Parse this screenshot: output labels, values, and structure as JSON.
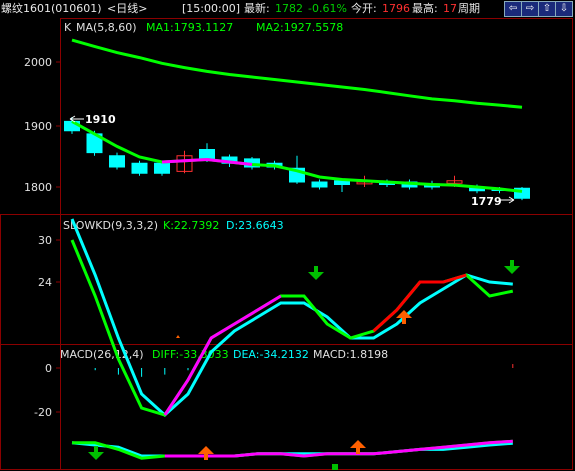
{
  "topbar": {
    "symbol": "螺纹1601",
    "code": "(010601)",
    "period": "<日线>",
    "time": "[15:00:00]",
    "latest_label": "最新:",
    "latest_value": "1782",
    "change": "-0.61%",
    "open_label": "今开:",
    "open_value": "1796",
    "high_label": "最高:",
    "high_value": "17",
    "weekly_tab": "周期",
    "btn_prev": "⇦",
    "btn_next": "⇨",
    "btn_up": "⇧",
    "btn_down": "⇩"
  },
  "colors": {
    "grid": "#8b0000",
    "up": "#ff3030",
    "down": "#00ffff",
    "ma1": "#00ff00",
    "ma2": "#00ff00",
    "k": "#ff0000",
    "d": "#00ffff",
    "magenta": "#ff00ff"
  },
  "main_panel": {
    "label_k": "K",
    "label_ma": "MA(5,8,60)",
    "label_ma1": "MA1:1793.1127",
    "label_ma2": "MA2:1927.5578",
    "high_marker": "1910",
    "low_marker": "1779",
    "yticks": [
      "2000",
      "1900",
      "1800"
    ]
  },
  "kd_panel": {
    "title": "SLOWKD(9,3,3,2)",
    "k_text": "K:22.7392",
    "d_text": "D:23.6643",
    "yticks": [
      "30",
      "24"
    ]
  },
  "macd_panel": {
    "title": "MACD(26,12,4)",
    "diff_text": "DIFF:-33.3033",
    "dea_text": "DEA:-34.2132",
    "macd_text": "MACD:1.8198",
    "yticks": [
      "0",
      "-20"
    ]
  },
  "chart_data": {
    "type": "candlestick",
    "price_scale": {
      "ticks": [
        2000,
        1900,
        1800
      ]
    },
    "candles": [
      {
        "open": 1905,
        "close": 1890,
        "high": 1912,
        "low": 1885
      },
      {
        "open": 1885,
        "close": 1855,
        "high": 1890,
        "low": 1850
      },
      {
        "open": 1850,
        "close": 1832,
        "high": 1855,
        "low": 1828
      },
      {
        "open": 1838,
        "close": 1822,
        "high": 1842,
        "low": 1818
      },
      {
        "open": 1838,
        "close": 1822,
        "high": 1842,
        "low": 1818
      },
      {
        "open": 1825,
        "close": 1850,
        "high": 1858,
        "low": 1822
      },
      {
        "open": 1860,
        "close": 1845,
        "high": 1870,
        "low": 1840
      },
      {
        "open": 1848,
        "close": 1838,
        "high": 1852,
        "low": 1832
      },
      {
        "open": 1845,
        "close": 1832,
        "high": 1848,
        "low": 1828
      },
      {
        "open": 1838,
        "close": 1832,
        "high": 1842,
        "low": 1828
      },
      {
        "open": 1830,
        "close": 1808,
        "high": 1850,
        "low": 1805
      },
      {
        "open": 1808,
        "close": 1800,
        "high": 1812,
        "low": 1796
      },
      {
        "open": 1810,
        "close": 1804,
        "high": 1814,
        "low": 1792
      },
      {
        "open": 1805,
        "close": 1808,
        "high": 1818,
        "low": 1800
      },
      {
        "open": 1808,
        "close": 1804,
        "high": 1812,
        "low": 1800
      },
      {
        "open": 1808,
        "close": 1800,
        "high": 1812,
        "low": 1796
      },
      {
        "open": 1805,
        "close": 1800,
        "high": 1810,
        "low": 1796
      },
      {
        "open": 1806,
        "close": 1810,
        "high": 1818,
        "low": 1800
      },
      {
        "open": 1800,
        "close": 1794,
        "high": 1804,
        "low": 1790
      },
      {
        "open": 1796,
        "close": 1795,
        "high": 1800,
        "low": 1790
      },
      {
        "open": 1798,
        "close": 1782,
        "high": 1800,
        "low": 1779
      }
    ],
    "ma1": [
      1905,
      1885,
      1865,
      1848,
      1840,
      1842,
      1844,
      1840,
      1836,
      1834,
      1826,
      1816,
      1812,
      1810,
      1808,
      1806,
      1804,
      1803,
      1800,
      1797,
      1793
    ],
    "ma2": [
      2035,
      2025,
      2015,
      2007,
      1998,
      1991,
      1985,
      1980,
      1976,
      1972,
      1968,
      1964,
      1960,
      1956,
      1951,
      1946,
      1941,
      1938,
      1934,
      1931,
      1927.6
    ],
    "kd": {
      "k": [
        30,
        22,
        13,
        6,
        5,
        10,
        16,
        18,
        20,
        22,
        22,
        18,
        16,
        17,
        20,
        24,
        24,
        25,
        22,
        22.7
      ],
      "d": [
        33,
        25,
        16,
        8,
        5,
        8,
        14,
        17,
        19,
        21,
        21,
        19,
        16,
        16,
        18,
        21,
        23,
        25,
        24,
        23.7
      ],
      "yticks": [
        30,
        24
      ]
    },
    "macd": {
      "diff": [
        -34,
        -34,
        -37,
        -41,
        -40,
        -40,
        -40,
        -40,
        -39,
        -39,
        -40,
        -39,
        -39,
        -39,
        -38,
        -37,
        -36,
        -35,
        -34,
        -33.3
      ],
      "dea": [
        -34,
        -35,
        -36,
        -40,
        -40,
        -40,
        -40,
        -40,
        -39,
        -39,
        -39,
        -39,
        -39,
        -39,
        -38,
        -37,
        -37,
        -36,
        -35,
        -34.2
      ],
      "bars": [
        0,
        -1,
        -3,
        -4,
        -3,
        -1,
        0,
        0,
        0,
        0,
        0,
        0,
        0,
        0,
        0,
        0,
        0,
        0,
        0,
        1.8
      ],
      "yticks": [
        0,
        -20
      ]
    }
  }
}
